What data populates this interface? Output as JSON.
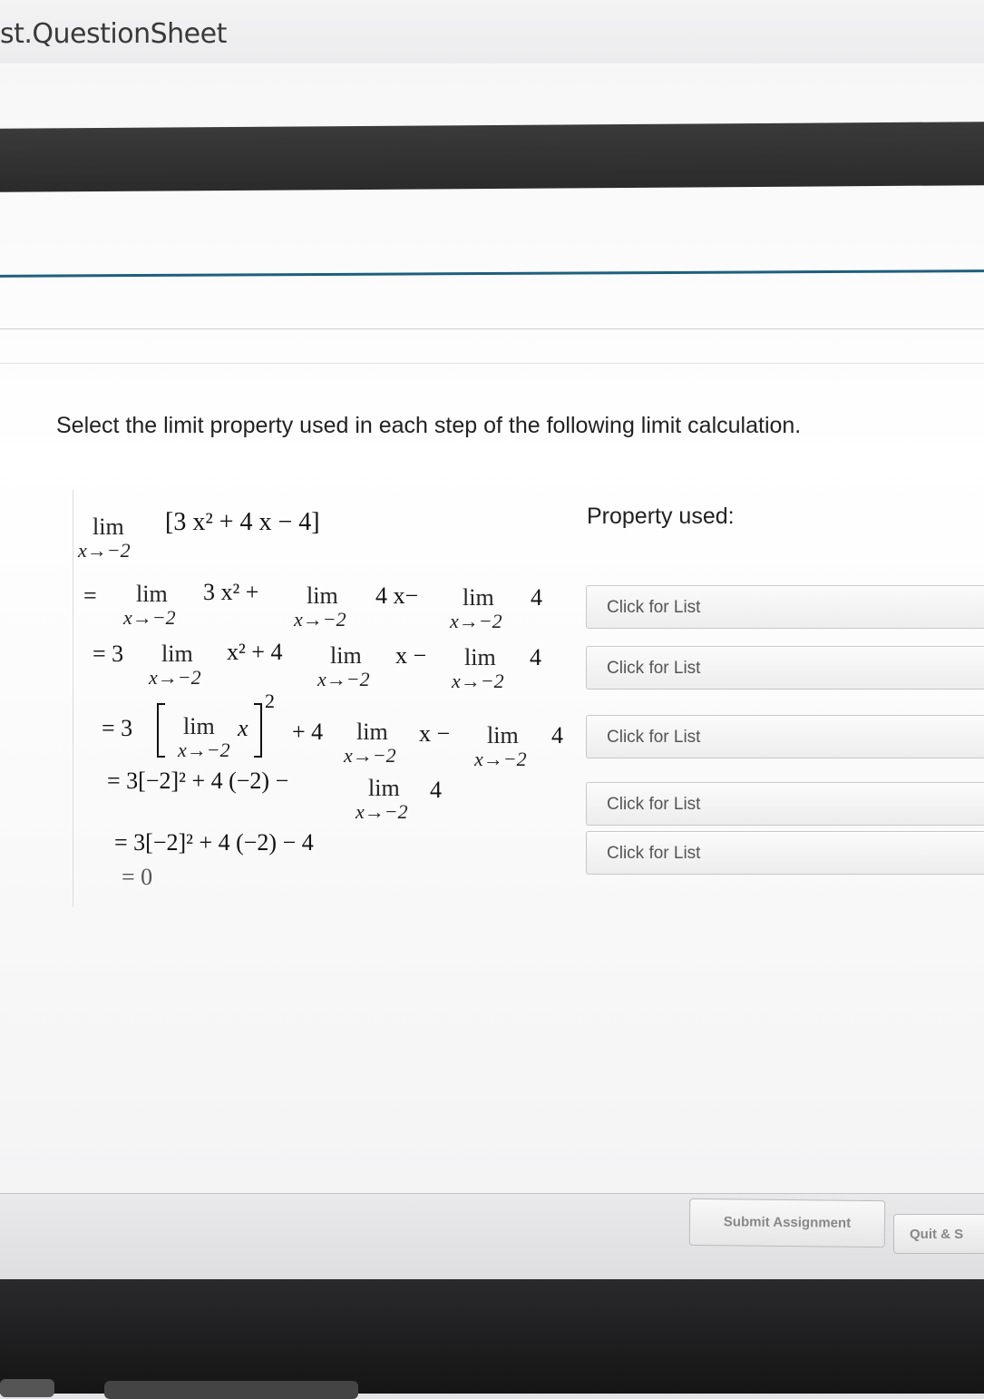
{
  "window": {
    "title": "st.QuestionSheet"
  },
  "question": {
    "prompt": "Select the limit property used in each step of the following limit calculation."
  },
  "property_header": "Property used:",
  "steps": [
    {
      "button_label": "Click for List"
    },
    {
      "button_label": "Click for List"
    },
    {
      "button_label": "Click for List"
    },
    {
      "button_label": "Click for List"
    },
    {
      "button_label": "Click for List"
    }
  ],
  "math": {
    "lim": "lim",
    "sub": "x→−2",
    "line0_expr": "[3 x² + 4 x − 4]",
    "line1_eq": "=",
    "line1_a": "3 x² +",
    "line1_b": "4 x−",
    "line1_c": "4",
    "line2_eq": "= 3",
    "line2_a": "x² + 4",
    "line2_b": "x −",
    "line2_c": "4",
    "line3_eq": "= 3",
    "line3_inner": "x",
    "line3_exp": "2",
    "line3_a": "+ 4",
    "line3_b": "x −",
    "line3_c": "4",
    "line4_a": "= 3[−2]² + 4 (−2) −",
    "line4_c": "4",
    "line5": "= 3[−2]² + 4 (−2) − 4",
    "line6": "= 0"
  },
  "footer": {
    "submit_label": "Submit Assignment",
    "quit_label": "Quit & S"
  }
}
